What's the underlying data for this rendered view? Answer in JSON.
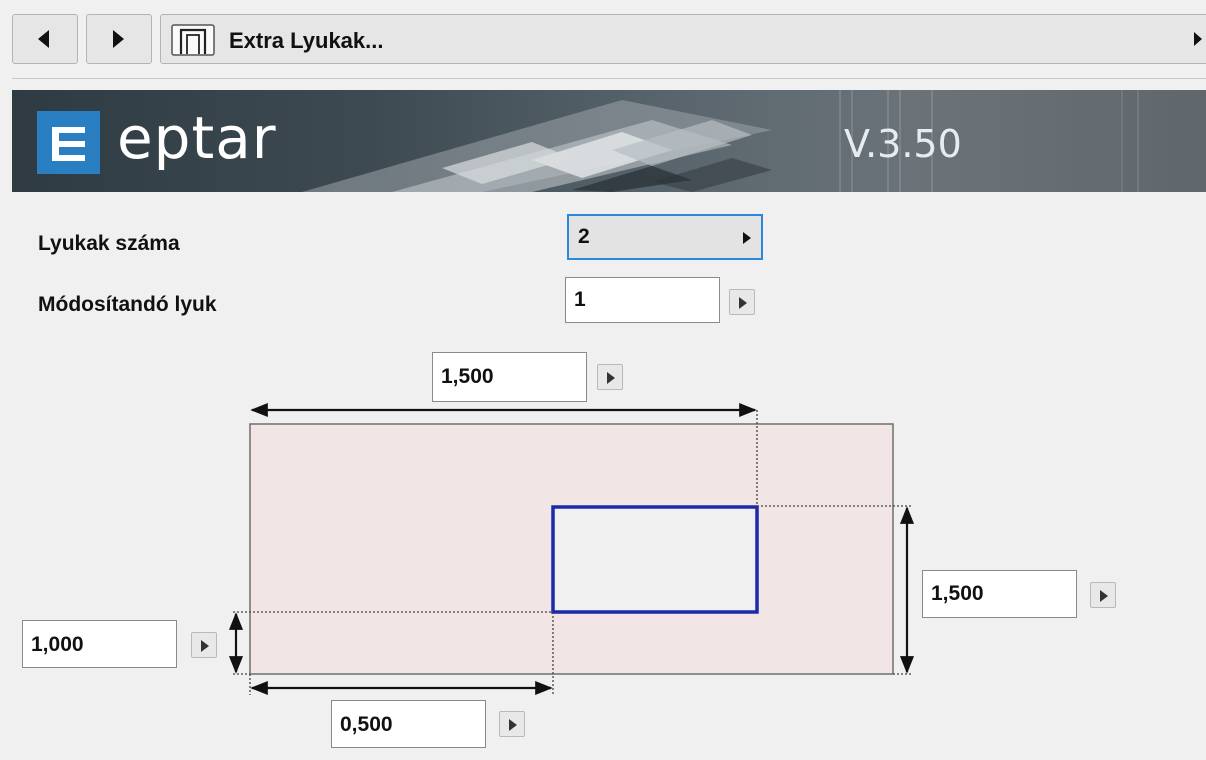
{
  "nav": {
    "back_icon": "triangle-left-icon",
    "forward_icon": "triangle-right-icon",
    "title": "Extra Lyukak...",
    "title_icon": "object-outline-icon",
    "more_icon": "triangle-right-icon"
  },
  "banner": {
    "logo_text": "eptar",
    "version": "V.3.50",
    "logo_color": "#2a7ec2"
  },
  "settings": {
    "holes_count_label": "Lyukak száma",
    "holes_count_value": "2",
    "editable_hole_label": "Módosítandó lyuk",
    "editable_hole_value": "1"
  },
  "dimensions": {
    "top_width": "1,500",
    "right_height": "1,500",
    "left_offset": "1,000",
    "bottom_offset": "0,500"
  },
  "colors": {
    "wall_fill": "#f1e5e6",
    "hole_outline": "#1a2aa8",
    "focus_border": "#2b87d8"
  }
}
